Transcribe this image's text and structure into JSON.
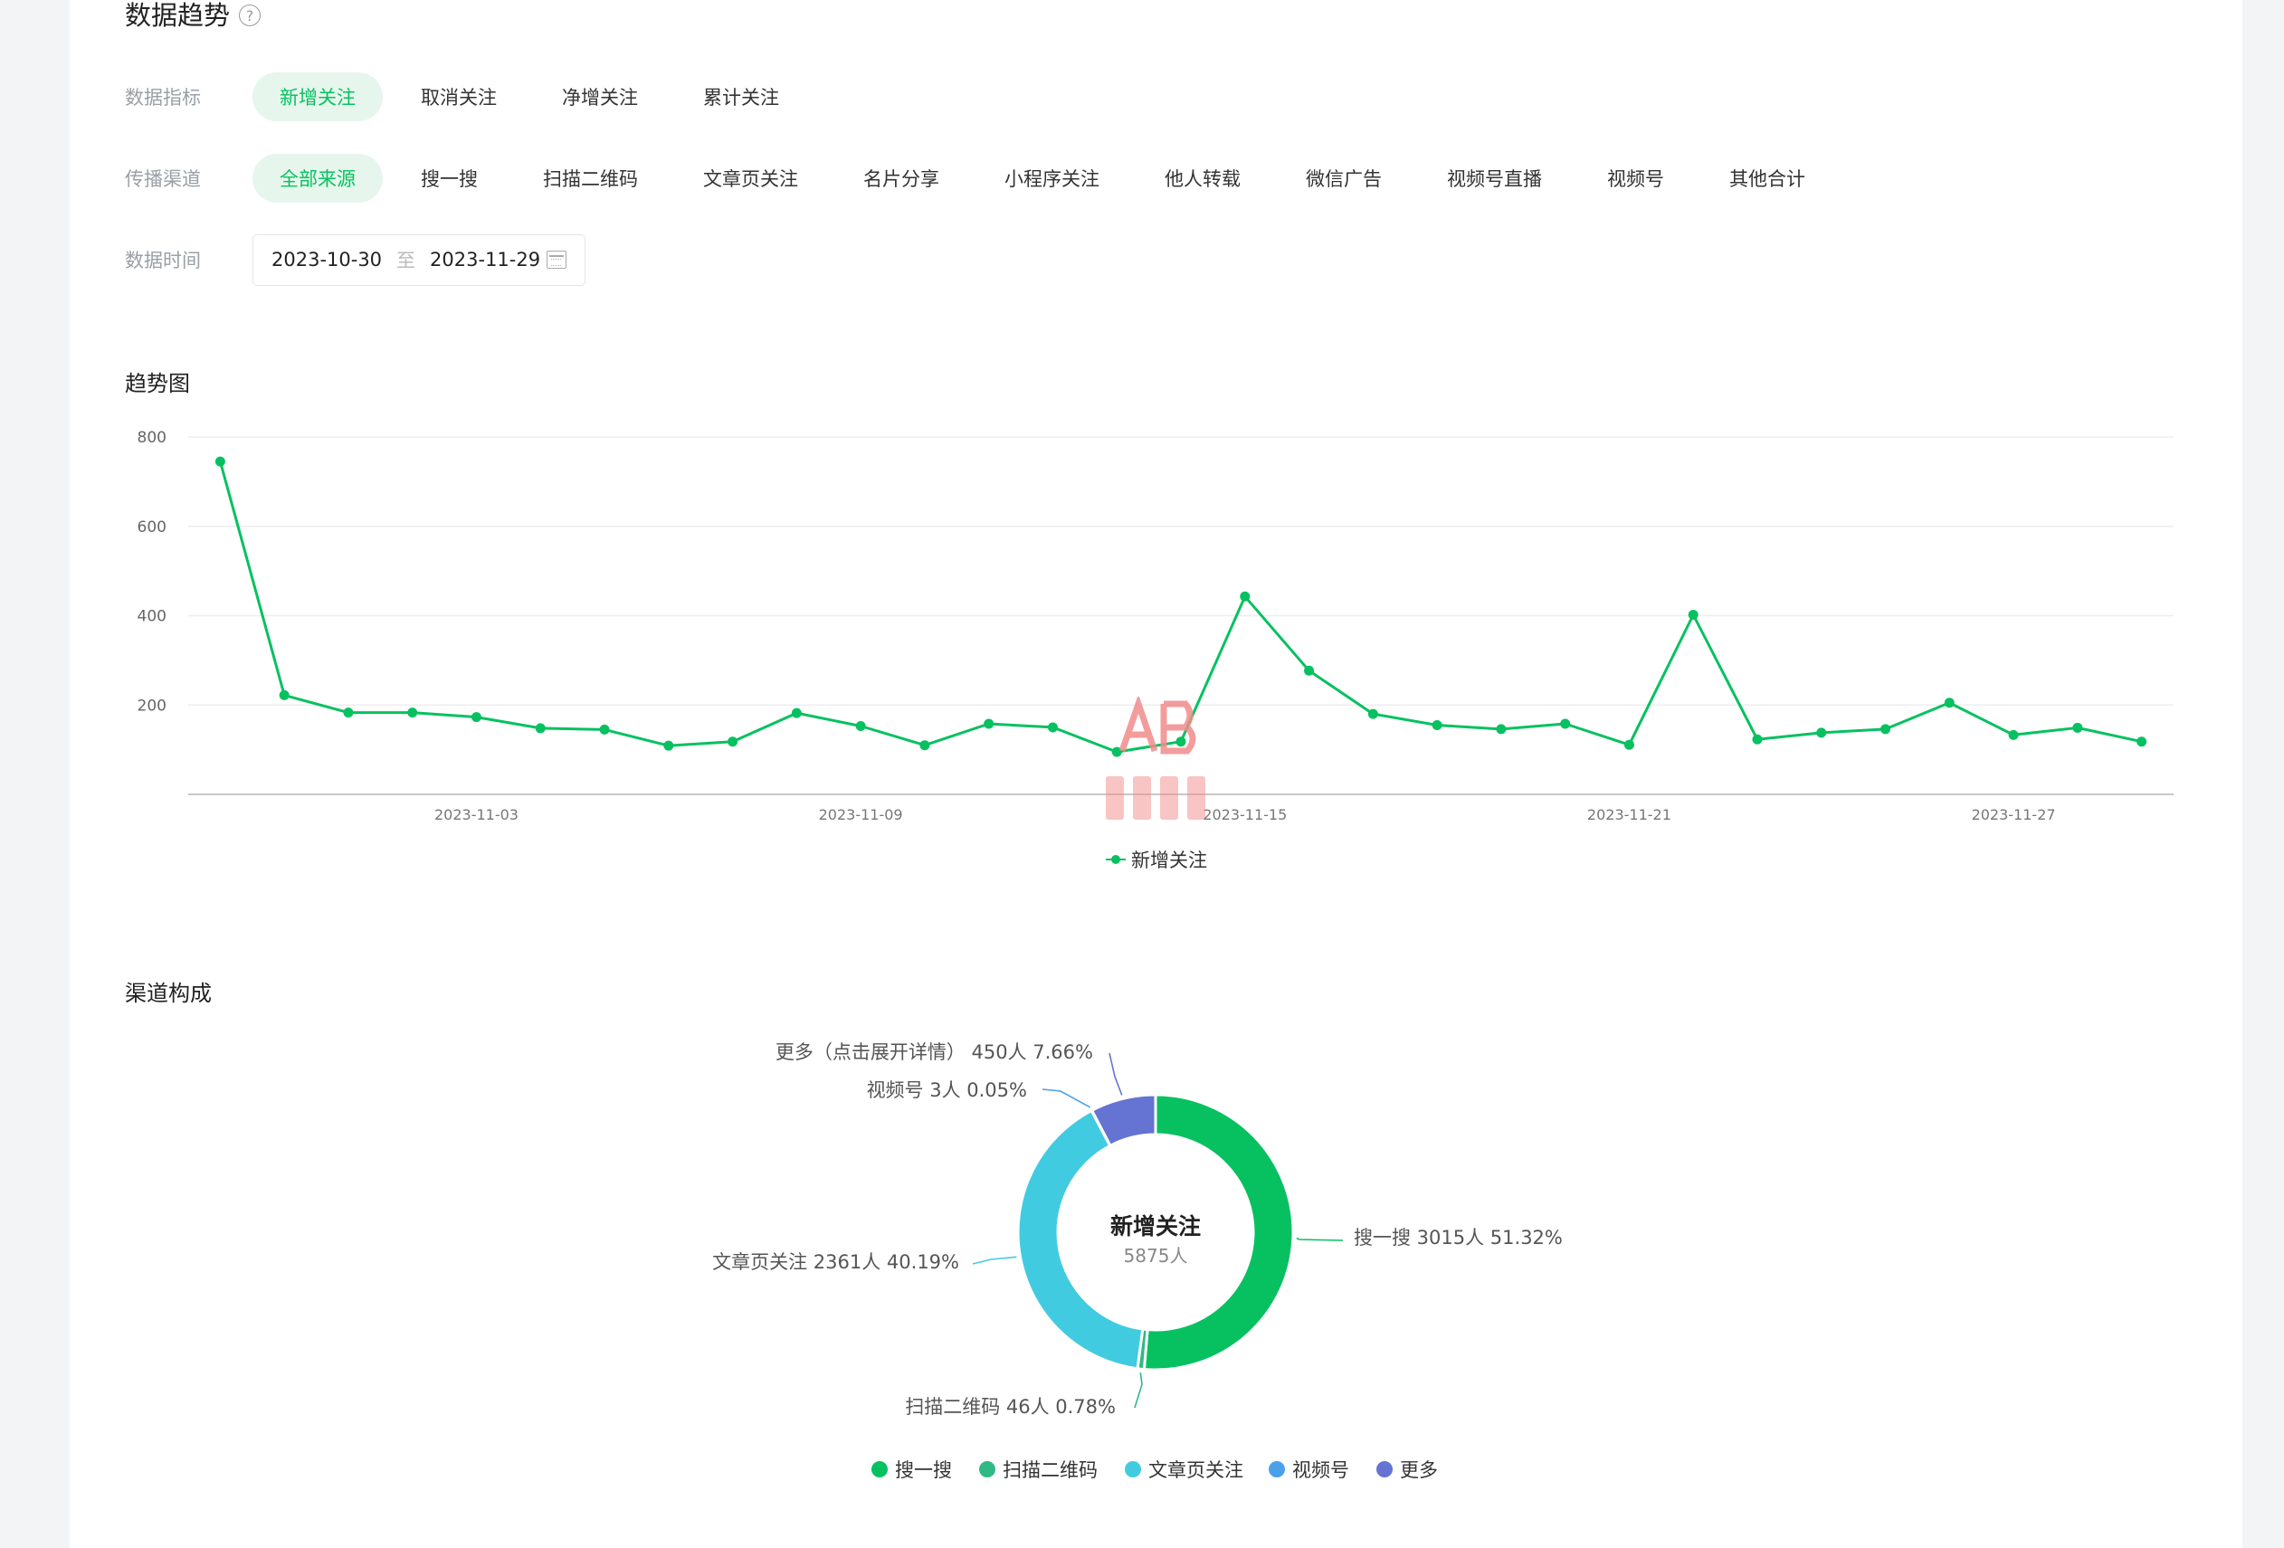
{
  "header": {
    "title": "数据趋势",
    "help_icon": "question-circle-icon"
  },
  "filters": {
    "metric": {
      "label": "数据指标",
      "options": [
        "新增关注",
        "取消关注",
        "净增关注",
        "累计关注"
      ],
      "selected": 0
    },
    "channel": {
      "label": "传播渠道",
      "options": [
        "全部来源",
        "搜一搜",
        "扫描二维码",
        "文章页关注",
        "名片分享",
        "小程序关注",
        "他人转载",
        "微信广告",
        "视频号直播",
        "视频号",
        "其他合计"
      ],
      "selected": 0
    },
    "date": {
      "label": "数据时间",
      "start": "2023-10-30",
      "separator": "至",
      "end": "2023-11-29",
      "icon": "calendar-icon"
    }
  },
  "trend": {
    "title": "趋势图"
  },
  "composition": {
    "title": "渠道构成"
  },
  "colors": {
    "accent": "#07c160",
    "chip_active_bg": "#e6f6ec",
    "line": "#07c160",
    "grid": "#eeeeee"
  },
  "chart_data": [
    {
      "type": "line",
      "title": "",
      "ylim": [
        0,
        800
      ],
      "yticks": [
        "800",
        "600",
        "400",
        "200"
      ],
      "x_tick_labels": [
        "2023-11-03",
        "2023-11-09",
        "2023-11-15",
        "2023-11-21",
        "2023-11-27"
      ],
      "x": [
        "2023-10-30",
        "2023-10-31",
        "2023-11-01",
        "2023-11-02",
        "2023-11-03",
        "2023-11-04",
        "2023-11-05",
        "2023-11-06",
        "2023-11-07",
        "2023-11-08",
        "2023-11-09",
        "2023-11-10",
        "2023-11-11",
        "2023-11-12",
        "2023-11-13",
        "2023-11-14",
        "2023-11-15",
        "2023-11-16",
        "2023-11-17",
        "2023-11-18",
        "2023-11-19",
        "2023-11-20",
        "2023-11-21",
        "2023-11-22",
        "2023-11-23",
        "2023-11-24",
        "2023-11-25",
        "2023-11-26",
        "2023-11-27",
        "2023-11-28",
        "2023-11-29"
      ],
      "series": [
        {
          "name": "新增关注",
          "color": "#07c160",
          "values": [
            745,
            222,
            183,
            183,
            173,
            148,
            145,
            109,
            118,
            182,
            153,
            110,
            158,
            150,
            95,
            118,
            443,
            277,
            180,
            155,
            146,
            158,
            111,
            402,
            123,
            138,
            146,
            205,
            133,
            149,
            118
          ]
        }
      ],
      "legend": "bottom-center",
      "grid": true
    },
    {
      "type": "pie",
      "variant": "donut",
      "center_title": "新增关注",
      "center_value": "5875人",
      "slices": [
        {
          "name": "搜一搜",
          "value": 3015,
          "percent": 51.32,
          "label": "搜一搜 3015人 51.32%",
          "color": "#07c160"
        },
        {
          "name": "扫描二维码",
          "value": 46,
          "percent": 0.78,
          "label": "扫描二维码 46人 0.78%",
          "color": "#2fb985"
        },
        {
          "name": "文章页关注",
          "value": 2361,
          "percent": 40.19,
          "label": "文章页关注 2361人 40.19%",
          "color": "#41cbe1"
        },
        {
          "name": "视频号",
          "value": 3,
          "percent": 0.05,
          "label": "视频号 3人 0.05%",
          "color": "#4ba0ea"
        },
        {
          "name": "更多",
          "value": 450,
          "percent": 7.66,
          "label": "更多（点击展开详情） 450人 7.66%",
          "color": "#6574d2"
        }
      ],
      "legend": [
        "搜一搜",
        "扫描二维码",
        "文章页关注",
        "视频号",
        "更多"
      ],
      "legend_position": "bottom-center"
    }
  ]
}
